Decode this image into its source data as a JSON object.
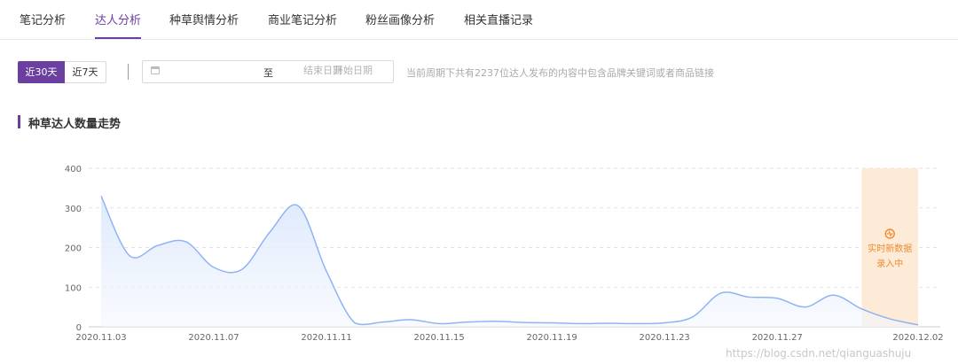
{
  "tabs": [
    {
      "label": "笔记分析"
    },
    {
      "label": "达人分析"
    },
    {
      "label": "种草舆情分析"
    },
    {
      "label": "商业笔记分析"
    },
    {
      "label": "粉丝画像分析"
    },
    {
      "label": "相关直播记录"
    }
  ],
  "active_tab": "达人分析",
  "filters": {
    "period_options": [
      "近30天",
      "近7天"
    ],
    "selected_period": "近30天",
    "start_placeholder": "开始日期",
    "separator": "至",
    "end_placeholder": "结束日期",
    "hint": "当前周期下共有2237位达人发布的内容中包含品牌关键词或者商品链接"
  },
  "section": {
    "title": "种草达人数量走势"
  },
  "live_badge": {
    "line1": "实时新数据",
    "line2": "录入中"
  },
  "watermark": "https://blog.csdn.net/qianguashuju",
  "colors": {
    "accent": "#6a3fa0",
    "line": "#8fb4f5",
    "fill": "#e9f0fd",
    "live_band": "#fdebd8",
    "live_text": "#f08a30"
  },
  "chart_data": {
    "type": "area",
    "title": "种草达人数量走势",
    "x": [
      "2020.11.03",
      "2020.11.04",
      "2020.11.05",
      "2020.11.06",
      "2020.11.07",
      "2020.11.08",
      "2020.11.09",
      "2020.11.10",
      "2020.11.11",
      "2020.11.12",
      "2020.11.13",
      "2020.11.14",
      "2020.11.15",
      "2020.11.16",
      "2020.11.17",
      "2020.11.18",
      "2020.11.19",
      "2020.11.20",
      "2020.11.21",
      "2020.11.22",
      "2020.11.23",
      "2020.11.24",
      "2020.11.25",
      "2020.11.26",
      "2020.11.27",
      "2020.11.28",
      "2020.11.29",
      "2020.11.30",
      "2020.12.01",
      "2020.12.02"
    ],
    "xtick_labels": [
      "2020.11.03",
      "2020.11.07",
      "2020.11.11",
      "2020.11.15",
      "2020.11.19",
      "2020.11.23",
      "2020.11.27",
      "2020.12.02"
    ],
    "series": [
      {
        "values": [
          330,
          180,
          205,
          215,
          150,
          145,
          240,
          305,
          140,
          10,
          12,
          18,
          8,
          12,
          14,
          11,
          10,
          8,
          9,
          8,
          10,
          25,
          85,
          75,
          72,
          50,
          80,
          45,
          20,
          5
        ]
      }
    ],
    "ylim": [
      0,
      400
    ],
    "yticks": [
      0,
      100,
      200,
      300,
      400
    ],
    "grid": true,
    "live_region": [
      "2020.11.30",
      "2020.12.02"
    ]
  }
}
